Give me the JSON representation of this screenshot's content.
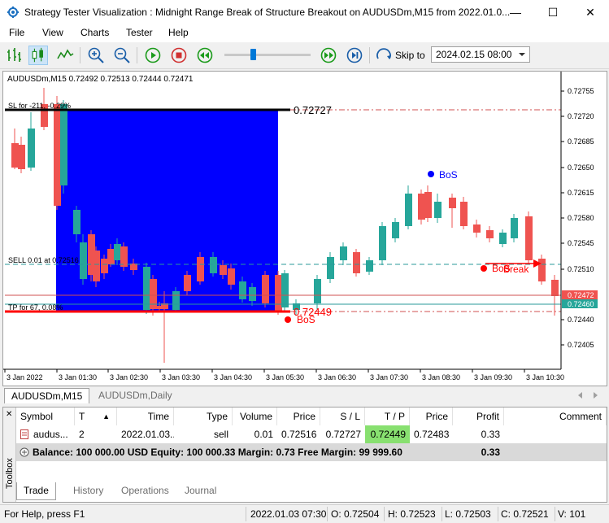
{
  "window": {
    "title": "Strategy Tester Visualization : Midnight Range Break of Structure Breakout on AUDUSDm,M15 from 2022.01.0...",
    "minimize_glyph": "—",
    "maximize_glyph": "☐",
    "close_glyph": "✕"
  },
  "menu": [
    "File",
    "View",
    "Charts",
    "Tester",
    "Help"
  ],
  "toolbar": {
    "skip_label": "Skip to",
    "skip_date": "2024.02.15 08:00"
  },
  "chart": {
    "header": "AUDUSDm,M15  0.72492 0.72513 0.72444 0.72471",
    "sl_label": "SL for -211, -0.29%",
    "sell_label": "SELL 0.01 at 0.72516",
    "tp_label": "TP for 67, 0.08%",
    "range_high_label": "0.72727",
    "range_low_label": "0.72449",
    "bos_labels": [
      "BoS",
      "BoS",
      "BoS"
    ],
    "break_label": "Break",
    "price_axis": [
      "0.72755",
      "0.72720",
      "0.72685",
      "0.72650",
      "0.72615",
      "0.72580",
      "0.72545",
      "0.72510",
      "0.72472",
      "0.72460",
      "0.72440",
      "0.72405"
    ],
    "time_axis": [
      "3 Jan 2022",
      "3 Jan 01:30",
      "3 Jan 02:30",
      "3 Jan 03:30",
      "3 Jan 04:30",
      "3 Jan 05:30",
      "3 Jan 06:30",
      "3 Jan 07:30",
      "3 Jan 08:30",
      "3 Jan 09:30",
      "3 Jan 10:30"
    ],
    "colors": {
      "bull": "#26a69a",
      "bear": "#ef5350",
      "range_box": "#0000ff",
      "sl": "#000000",
      "tp": "#ff0000",
      "bos_blue": "#0000ff",
      "bos_red": "#ff0000"
    }
  },
  "chart_tabs": [
    "AUDUSDm,M15",
    "AUDUSDm,Daily"
  ],
  "trade_table": {
    "headers": [
      "Symbol",
      "T",
      "Time",
      "Type",
      "Volume",
      "Price",
      "S / L",
      "T / P",
      "Price",
      "Profit",
      "Comment"
    ],
    "sort_glyph": "▲",
    "row": [
      "audus...",
      "2",
      "2022.01.03...",
      "sell",
      "0.01",
      "0.72516",
      "0.72727",
      "0.72449",
      "0.72483",
      "0.33",
      ""
    ],
    "balance_text": "Balance: 100 000.00 USD  Equity: 100 000.33  Margin: 0.73  Free Margin: 99 999.60",
    "balance_profit": "0.33"
  },
  "toolbox_label": "Toolbox",
  "bottom_tabs": [
    "Trade",
    "History",
    "Operations",
    "Journal"
  ],
  "status": {
    "help": "For Help, press F1",
    "time": "2022.01.03 07:30",
    "open": "O: 0.72504",
    "high": "H: 0.72523",
    "low": "L: 0.72503",
    "close": "C: 0.72521",
    "volume": "V: 101"
  }
}
